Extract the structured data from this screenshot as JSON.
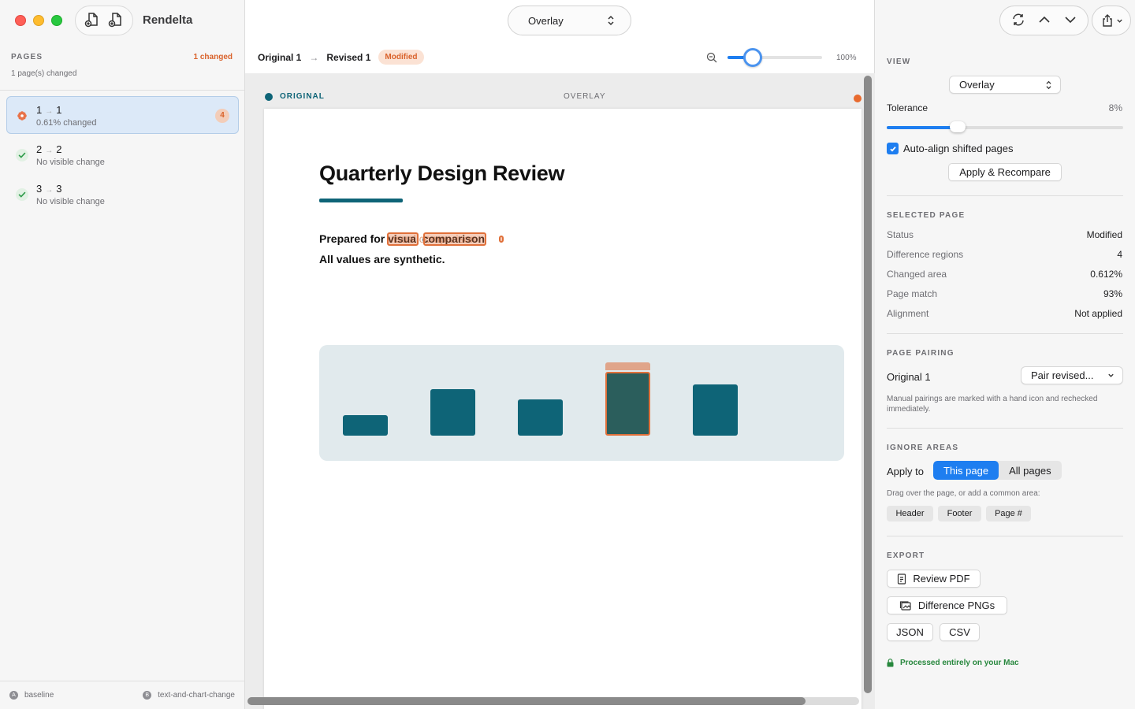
{
  "app": {
    "title": "Rendelta"
  },
  "sidebar": {
    "section_label": "PAGES",
    "changed_summary": "1 changed",
    "subtitle": "1 page(s) changed",
    "pages": [
      {
        "from": "1",
        "to": "1",
        "status": "0.61% changed",
        "badge": "4",
        "icon": "diff-flower-icon"
      },
      {
        "from": "2",
        "to": "2",
        "status": "No visible change",
        "icon": "checkmark-icon"
      },
      {
        "from": "3",
        "to": "3",
        "status": "No visible change",
        "icon": "checkmark-icon"
      }
    ],
    "footer": {
      "left": "baseline",
      "right": "text-and-chart-change"
    }
  },
  "toolbar": {
    "mode": "Overlay"
  },
  "crumbs": {
    "original": "Original 1",
    "revised": "Revised 1",
    "badge": "Modified"
  },
  "zoom": {
    "value_label": "100%",
    "level": 0.27
  },
  "canvas": {
    "left_label": "ORIGINAL",
    "center_label": "OVERLAY",
    "document": {
      "title": "Quarterly Design Review",
      "line1": "Prepared for visual comparison",
      "ghost": "visual comparison",
      "line2": "All values are synthetic."
    },
    "chart_bars": [
      {
        "value": 0.18,
        "changed": false
      },
      {
        "value": 0.41,
        "changed": false
      },
      {
        "value": 0.32,
        "changed": false
      },
      {
        "value": 0.56,
        "changed": true,
        "original_value": 0.62
      },
      {
        "value": 0.45,
        "changed": false
      }
    ]
  },
  "inspector": {
    "view": {
      "title": "VIEW",
      "mode": "Overlay",
      "tolerance_label": "Tolerance",
      "tolerance_value": "8%",
      "tolerance_level": 0.3,
      "auto_align_label": "Auto-align shifted pages",
      "apply_button": "Apply & Recompare"
    },
    "selected": {
      "title": "SELECTED PAGE",
      "rows": [
        {
          "k": "Status",
          "v": "Modified"
        },
        {
          "k": "Difference regions",
          "v": "4"
        },
        {
          "k": "Changed area",
          "v": "0.612%"
        },
        {
          "k": "Page match",
          "v": "93%"
        },
        {
          "k": "Alignment",
          "v": "Not applied"
        }
      ]
    },
    "pairing": {
      "title": "PAGE PAIRING",
      "label": "Original 1",
      "select": "Pair revised...",
      "note": "Manual pairings are marked with a hand icon and rechecked immediately."
    },
    "ignore": {
      "title": "IGNORE AREAS",
      "apply_label": "Apply to",
      "this_page": "This page",
      "all_pages": "All pages",
      "note": "Drag over the page, or add a common area:",
      "chips": [
        "Header",
        "Footer",
        "Page #"
      ]
    },
    "export": {
      "title": "EXPORT",
      "review_pdf": "Review PDF",
      "diff_pngs": "Difference PNGs",
      "json": "JSON",
      "csv": "CSV"
    },
    "privacy": "Processed entirely on your Mac"
  },
  "colors": {
    "accent": "#1e7ef0",
    "changed": "#d9622b",
    "brand_teal": "#0e6477"
  }
}
